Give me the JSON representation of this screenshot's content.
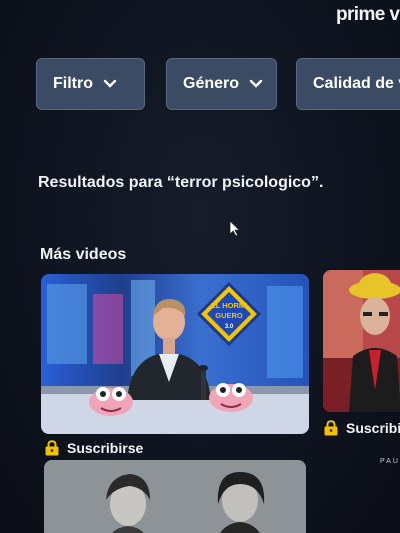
{
  "header": {
    "logo_text": "prime vi"
  },
  "filters": [
    {
      "label": "Filtro"
    },
    {
      "label": "Género"
    },
    {
      "label": "Calidad de v"
    }
  ],
  "results": {
    "label": "Resultados para “terror psicologico”."
  },
  "section": {
    "title": "Más videos"
  },
  "cards": [
    {
      "thumbnail_sign": "EL HORMIGUERO",
      "badge_text": "3.0",
      "cta_label": "Suscribirse",
      "cta_icon": "lock-icon"
    },
    {
      "cta_label": "Suscribirse",
      "cta_icon": "lock-icon",
      "caption_fragment": "PAU"
    },
    {
      "thumbnail_fragment": "..."
    }
  ],
  "colors": {
    "background": "#0d111b",
    "filter_button": "#3b4b63",
    "subscribe_icon": "#f2c200",
    "text": "#f1f3f6"
  }
}
